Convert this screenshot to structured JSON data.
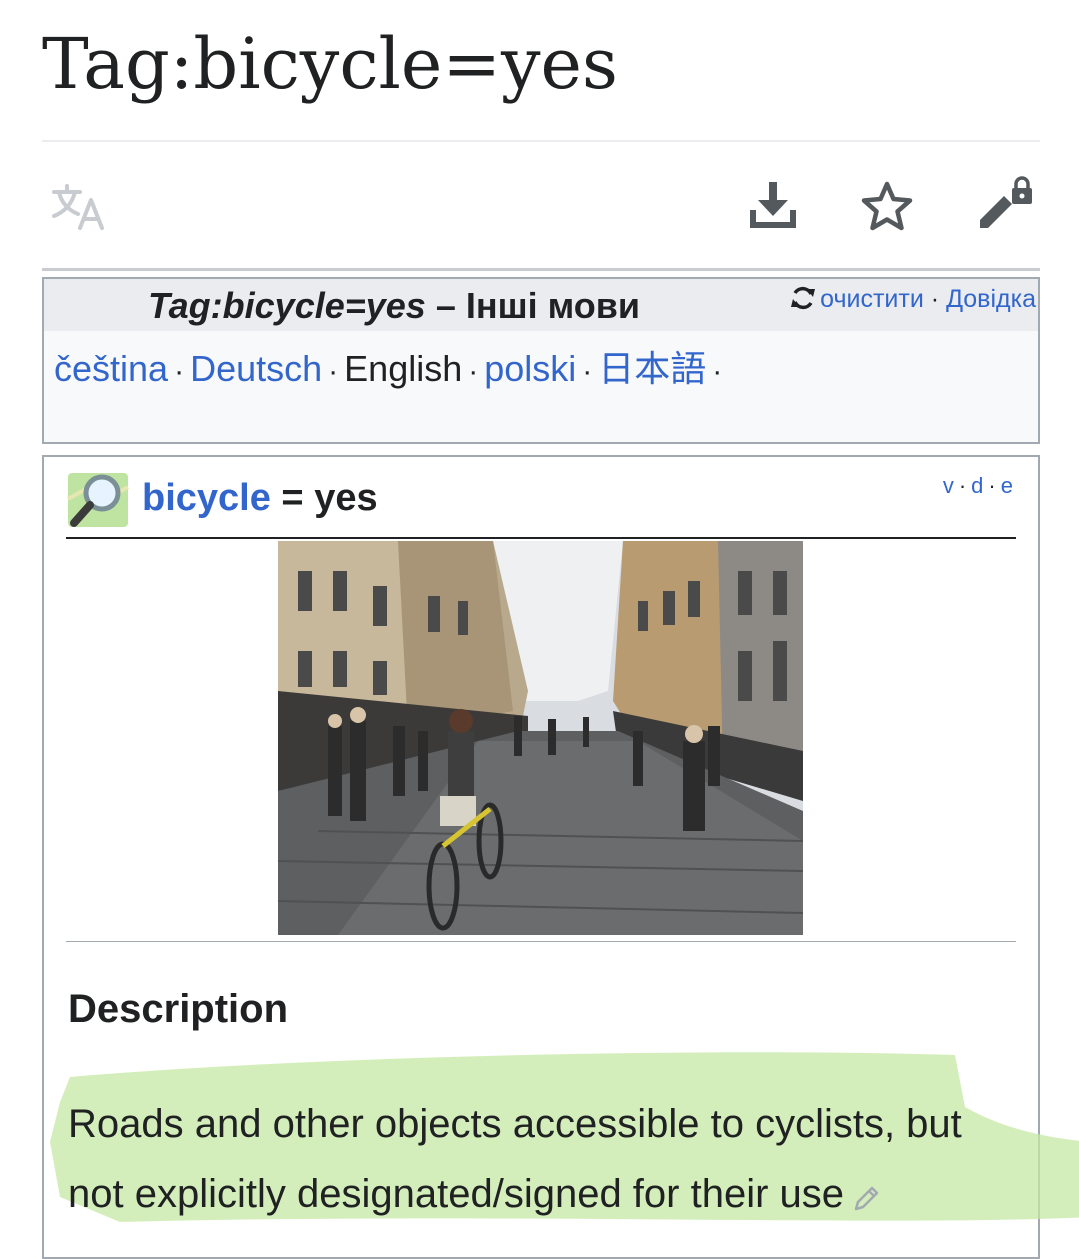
{
  "page": {
    "title": "Tag:bicycle=yes"
  },
  "actions": {
    "language_icon": "translate-icon",
    "download_icon": "download-icon",
    "watch_icon": "star-icon",
    "edit_icon": "edit-locked-icon"
  },
  "languages": {
    "header_tag": "Tag:bicycle=yes",
    "header_suffix": " – Інші мови",
    "purge_label": "очистити",
    "separator": "·",
    "help_label": "Довідка",
    "items": [
      {
        "label": "čeština",
        "link": true
      },
      {
        "label": "Deutsch",
        "link": true
      },
      {
        "label": "English",
        "link": false
      },
      {
        "label": "polski",
        "link": true
      },
      {
        "label": "日本語",
        "link": true
      }
    ]
  },
  "infobox": {
    "key": "bicycle",
    "equals": " = ",
    "value": "yes",
    "vde": {
      "v": "v",
      "d": "d",
      "e": "e"
    },
    "description_heading": "Description",
    "description_text": "Roads and other objects accessible to cyclists, but not explicitly designated/signed for their use",
    "highlight_color": "#c6e8a4"
  },
  "colors": {
    "link": "#3366cc",
    "text": "#202122",
    "border": "#a2a9b1"
  }
}
